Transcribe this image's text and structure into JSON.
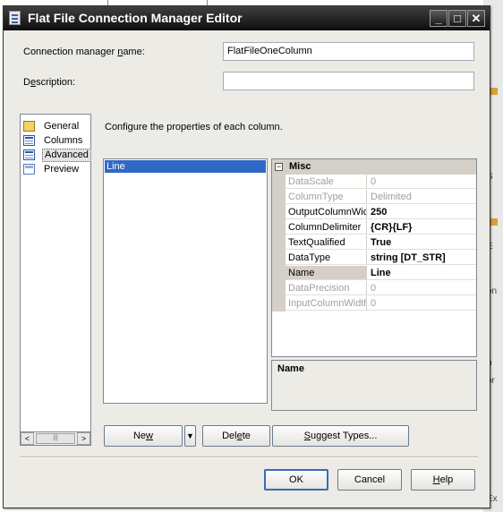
{
  "window": {
    "title": "Flat File Connection Manager Editor",
    "controls": {
      "minimize": "_",
      "maximize": "□",
      "close": "✕"
    }
  },
  "fields": {
    "name_label": {
      "pre": "Connection manager ",
      "key": "n",
      "post": "ame:"
    },
    "name_value": "FlatFileOneColumn",
    "description_label": {
      "pre": "D",
      "key": "e",
      "post": "scription:"
    },
    "description_value": ""
  },
  "nav": {
    "items": [
      {
        "label": "General",
        "icon": "general-icon",
        "selected": false
      },
      {
        "label": "Columns",
        "icon": "columns-icon",
        "selected": false
      },
      {
        "label": "Advanced",
        "icon": "advanced-icon",
        "selected": true
      },
      {
        "label": "Preview",
        "icon": "preview-icon",
        "selected": false
      }
    ],
    "scroll": {
      "left": "<",
      "thumb": "|||",
      "right": ">"
    }
  },
  "main": {
    "instruction": "Configure the properties of each column.",
    "columns": [
      "Line"
    ]
  },
  "property_grid": {
    "category": {
      "toggle": "−",
      "name": "Misc"
    },
    "rows": [
      {
        "name": "DataScale",
        "value": "0",
        "readonly": true
      },
      {
        "name": "ColumnType",
        "value": "Delimited",
        "readonly": true
      },
      {
        "name": "OutputColumnWidth",
        "value": "250",
        "readonly": false
      },
      {
        "name": "ColumnDelimiter",
        "value": "{CR}{LF}",
        "readonly": false
      },
      {
        "name": "TextQualified",
        "value": "True",
        "readonly": false
      },
      {
        "name": "DataType",
        "value": "string [DT_STR]",
        "readonly": false
      },
      {
        "name": "Name",
        "value": "Line",
        "readonly": false,
        "selected": true
      },
      {
        "name": "DataPrecision",
        "value": "0",
        "readonly": true
      },
      {
        "name": "InputColumnWidth",
        "value": "0",
        "readonly": true
      }
    ],
    "description_title": "Name"
  },
  "buttons": {
    "new": {
      "pre": "Ne",
      "key": "w",
      "post": ""
    },
    "new_dropdown": "▼",
    "delete": {
      "pre": "Del",
      "key": "e",
      "post": "te"
    },
    "suggest": {
      "pre": "",
      "key": "S",
      "post": "uggest Types..."
    },
    "ok": "OK",
    "cancel": "Cancel",
    "help": {
      "pre": "",
      "key": "H",
      "post": "elp"
    }
  },
  "background_fragments": [
    "S",
    "E",
    "on",
    "n",
    "or",
    "Ex"
  ]
}
